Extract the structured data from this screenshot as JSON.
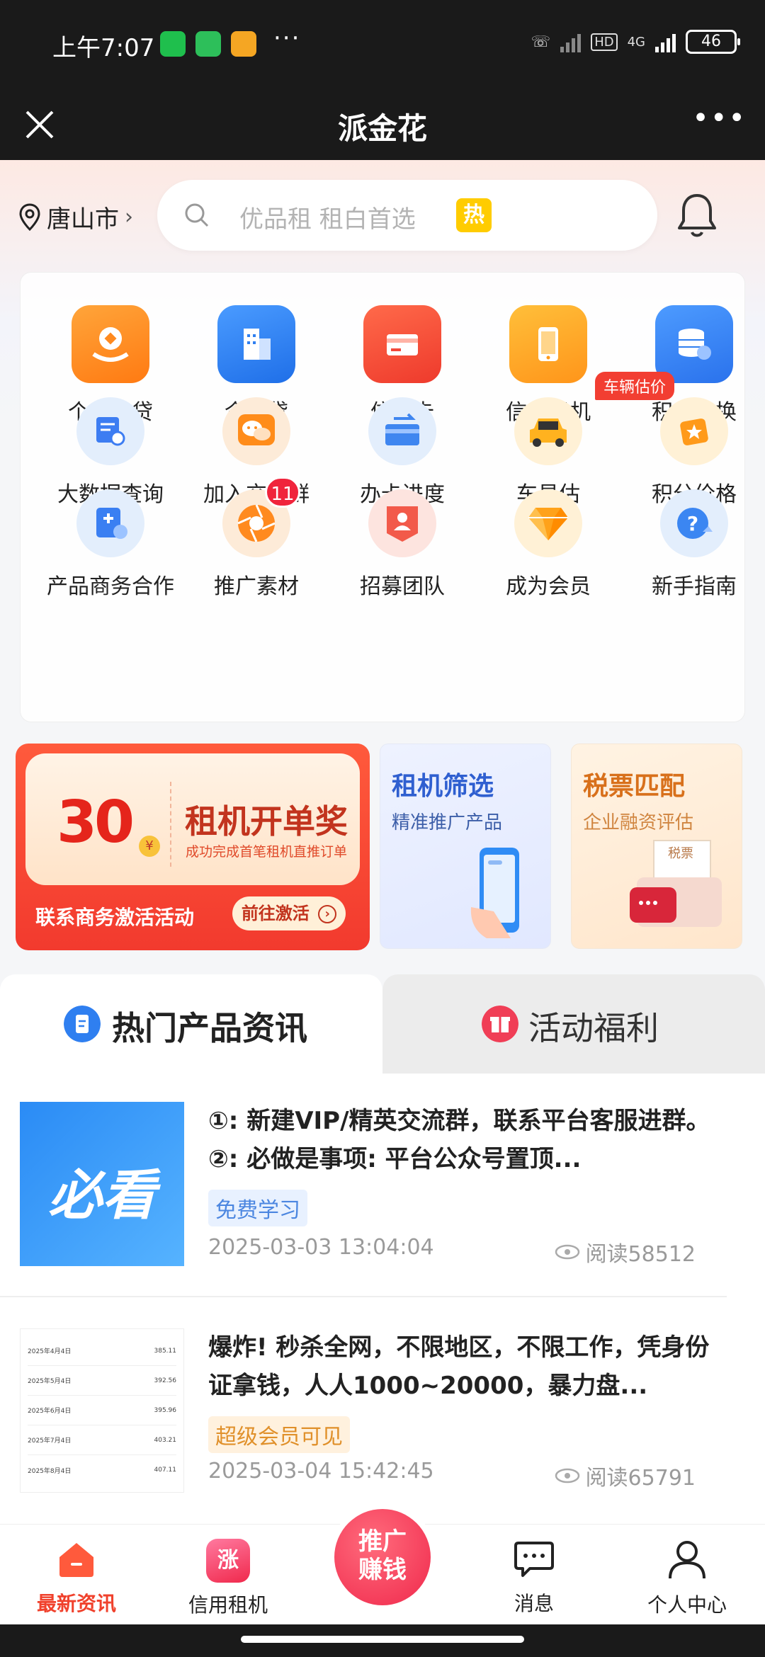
{
  "status_bar": {
    "time": "上午7:07",
    "battery": "46",
    "network": "4G",
    "hd": "HD"
  },
  "title_bar": {
    "title": "派金花"
  },
  "header": {
    "location": "唐山市",
    "search_placeholder": "优品租 租白首选",
    "hot_badge": "热"
  },
  "grid": {
    "items": [
      {
        "label": "个人信贷",
        "icon": "personal-loan-icon",
        "color": "#ff8a1f"
      },
      {
        "label": "企业贷",
        "icon": "building-icon",
        "color": "#2f7ff0"
      },
      {
        "label": "信用卡",
        "icon": "credit-card-icon",
        "color": "#f2483a"
      },
      {
        "label": "信用租机",
        "icon": "phone-icon",
        "color": "#ffa726"
      },
      {
        "label": "积分兑换",
        "icon": "database-icon",
        "color": "#3584f5"
      },
      {
        "label": "大数据查询",
        "icon": "data-search-icon",
        "color": "#3d7df2"
      },
      {
        "label": "加入交流群",
        "icon": "chat-icon",
        "color": "#ff8c1a"
      },
      {
        "label": "办卡进度",
        "icon": "card-progress-icon",
        "color": "#3f86f0"
      },
      {
        "label": "车易估",
        "icon": "car-icon",
        "color": "#ffb21f",
        "tag": "车辆估价"
      },
      {
        "label": "积分价格",
        "icon": "star-card-icon",
        "color": "#ff9a1a"
      },
      {
        "label": "产品商务合作",
        "icon": "business-icon",
        "color": "#3a7ff2"
      },
      {
        "label": "推广素材",
        "icon": "aperture-icon",
        "color": "#ff8a1f",
        "badge": "11"
      },
      {
        "label": "招募团队",
        "icon": "recruit-icon",
        "color": "#f25a4a"
      },
      {
        "label": "成为会员",
        "icon": "diamond-icon",
        "color": "#ffa21a"
      },
      {
        "label": "新手指南",
        "icon": "help-icon",
        "color": "#3b86f2"
      }
    ]
  },
  "banners": {
    "main": {
      "amount": "30",
      "currency": "¥",
      "title": "租机开单奖",
      "subtitle": "成功完成首笔租机直推订单",
      "cta": "联系商务激活活动",
      "button": "前往激活"
    },
    "filter": {
      "title": "租机筛选",
      "subtitle": "精准推广产品"
    },
    "tax": {
      "title": "税票匹配",
      "subtitle": "企业融资评估",
      "paper_label": "税票"
    }
  },
  "tabs": [
    {
      "label": "热门产品资讯",
      "active": true
    },
    {
      "label": "活动福利",
      "active": false
    }
  ],
  "articles": [
    {
      "title": "①: 新建VIP/精英交流群，联系平台客服进群。②: 必做是事项: 平台公众号置顶...",
      "tag": "免费学习",
      "date": "2025-03-03 13:04:04",
      "reads": "阅读58512",
      "thumb_text": "必看"
    },
    {
      "title": "爆炸! 秒杀全网，不限地区，不限工作，凭身份证拿钱，人人1000~20000，暴力盘...",
      "tag": "超级会员可见",
      "date": "2025-03-04 15:42:45",
      "reads": "阅读65791",
      "thumb_rows": [
        {
          "label": "2025年4月4日",
          "value": "385.11"
        },
        {
          "label": "2025年5月4日",
          "value": "392.56"
        },
        {
          "label": "2025年6月4日",
          "value": "395.96"
        },
        {
          "label": "2025年7月4日",
          "value": "403.21"
        },
        {
          "label": "2025年8月4日",
          "value": "407.11"
        }
      ]
    }
  ],
  "tab_bar": {
    "items": [
      {
        "label": "最新资讯",
        "active": true
      },
      {
        "label": "信用租机",
        "active": false
      },
      {
        "label": "消息",
        "active": false
      },
      {
        "label": "个人中心",
        "active": false
      }
    ],
    "promo_line1": "推广",
    "promo_line2": "赚钱",
    "rent_icon_text": "涨"
  },
  "colors": {
    "accent": "#f0412c",
    "brand_blue": "#2f7ff0",
    "tag_blue_bg": "#e8f1ff",
    "tag_orange_bg": "#fff1de"
  }
}
